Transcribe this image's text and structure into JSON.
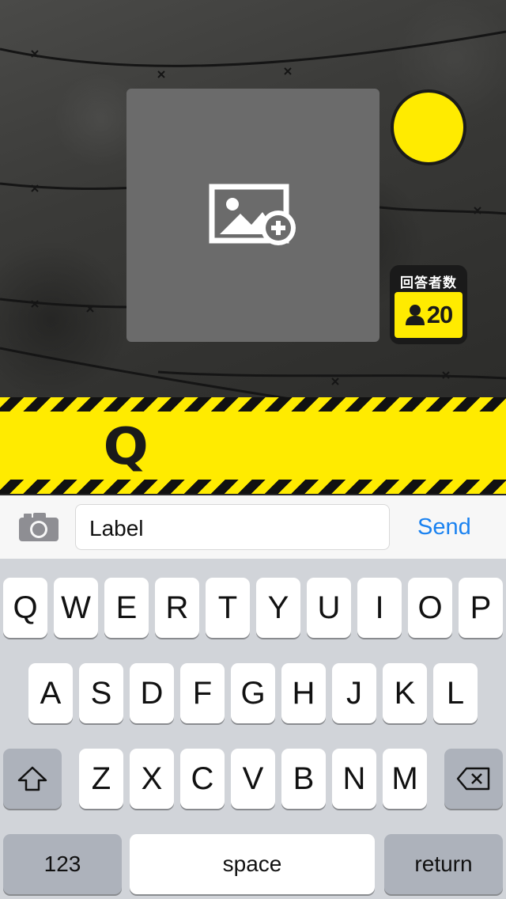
{
  "image_picker": {
    "icon": "add-photo-icon"
  },
  "respondents": {
    "title": "回答者数",
    "count": "20",
    "icon": "person-icon"
  },
  "question": {
    "prefix": "Q"
  },
  "composer": {
    "camera_icon": "camera-icon",
    "input_value": "Label",
    "send_label": "Send"
  },
  "keyboard": {
    "row1": [
      "Q",
      "W",
      "E",
      "R",
      "T",
      "Y",
      "U",
      "I",
      "O",
      "P"
    ],
    "row2": [
      "A",
      "S",
      "D",
      "F",
      "G",
      "H",
      "J",
      "K",
      "L"
    ],
    "row3": [
      "Z",
      "X",
      "C",
      "V",
      "B",
      "N",
      "M"
    ],
    "shift_icon": "shift-icon",
    "delete_icon": "delete-icon",
    "numbers_label": "123",
    "space_label": "space",
    "return_label": "return"
  },
  "colors": {
    "accent_yellow": "#ffeb00",
    "send_blue": "#1a82f0",
    "dark": "#1a1a1a"
  }
}
